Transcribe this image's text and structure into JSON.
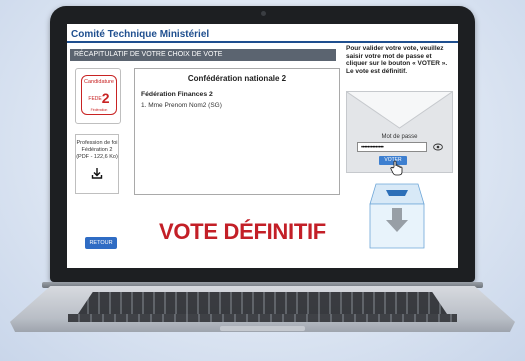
{
  "app": {
    "title": "Comité Technique Ministériel"
  },
  "recap": {
    "title": "RÉCAPITULATIF DE VOTRE CHOIX DE VOTE"
  },
  "candidature": {
    "label": "Candidature",
    "code": "FEDE",
    "number": "2",
    "detail": "Fédération"
  },
  "profession": {
    "line1": "Profession de foi",
    "line2": "Fédération 2",
    "line3": "(PDF - 122,6 Ko)",
    "icon": "download-icon"
  },
  "choice": {
    "confederation": "Confédération nationale 2",
    "federation": "Fédération Finances 2",
    "candidate": "1. Mme Prenom Nom2 (SG)"
  },
  "instructions": {
    "text": "Pour valider votre vote, veuillez saisir votre mot de passe et cliquer sur le bouton « VOTER ». Le vote est définitif."
  },
  "password": {
    "label": "Mot de passe",
    "value": "••••••••••••••",
    "toggle_icon": "eye-icon"
  },
  "vote_button": {
    "label": "VOTER"
  },
  "banner": {
    "text": "VOTE DÉFINITIF"
  },
  "back_button": {
    "label": "RETOUR"
  },
  "colors": {
    "brand_blue": "#1f4f8f",
    "header_gray": "#5b6470",
    "accent_red": "#c31f27",
    "button_blue": "#2f6cc4"
  }
}
